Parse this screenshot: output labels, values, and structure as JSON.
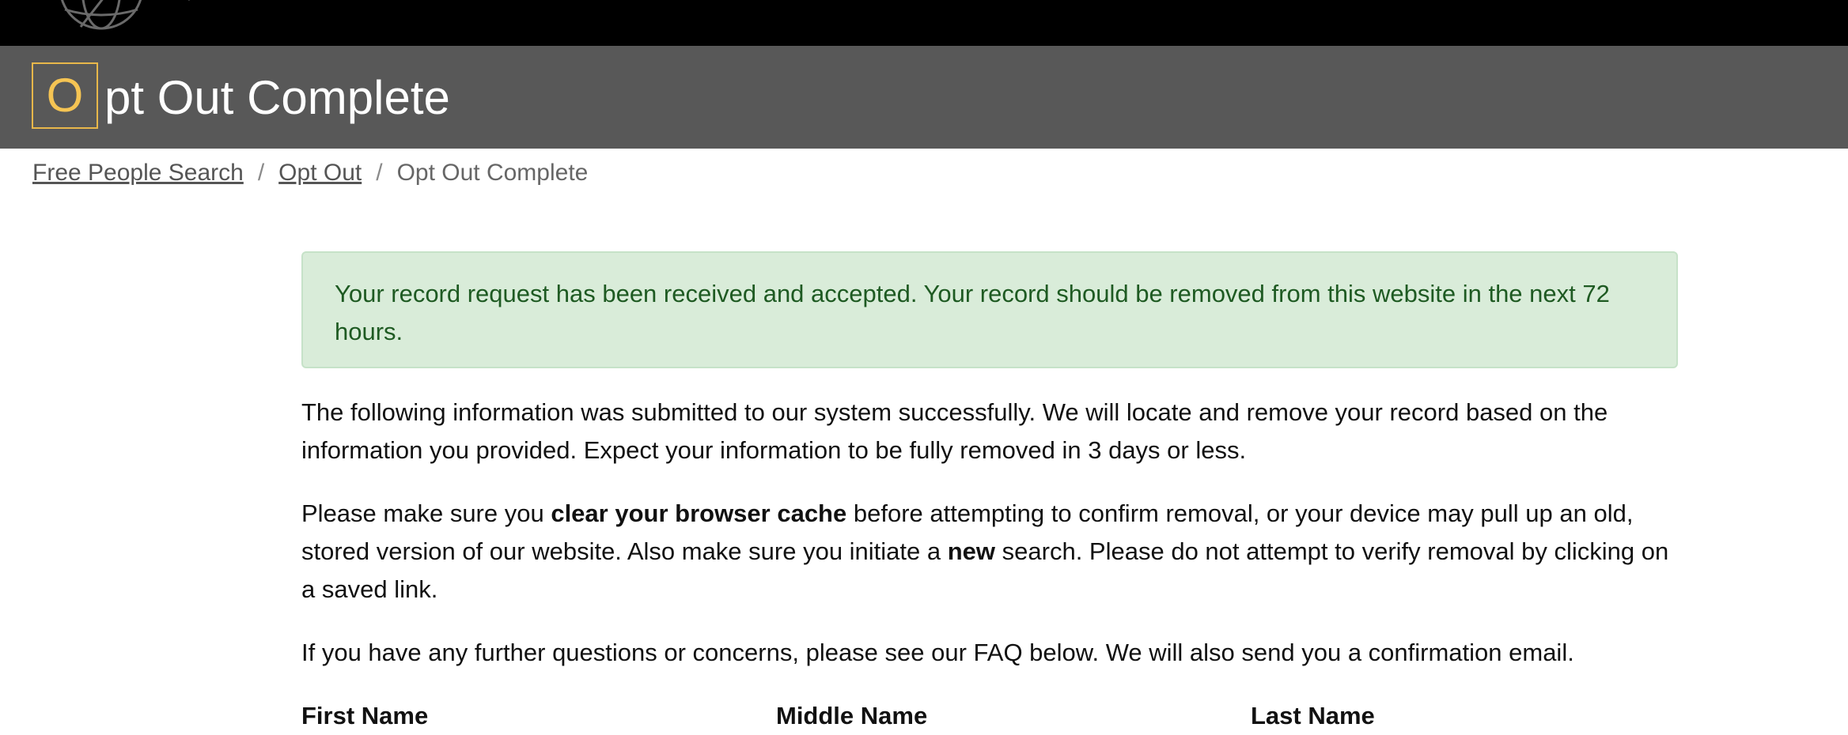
{
  "header": {
    "title_initial": "O",
    "title_rest": "pt Out Complete"
  },
  "breadcrumb": {
    "items": [
      {
        "label": "Free People Search"
      },
      {
        "label": "Opt Out"
      },
      {
        "label": "Opt Out Complete"
      }
    ],
    "separator": "/"
  },
  "alert": {
    "message": "Your record request has been received and accepted. Your record should be removed from this website in the next 72 hours."
  },
  "content": {
    "p1": "The following information was submitted to our system successfully. We will locate and remove your record based on the information you provided. Expect your information to be fully removed in 3 days or less.",
    "p2_part1": "Please make sure you ",
    "p2_bold1": "clear your browser cache",
    "p2_part2": " before attempting to confirm removal, or your device may pull up an old, stored version of our website. Also make sure you initiate a ",
    "p2_bold2": "new",
    "p2_part3": " search. Please do not attempt to verify removal by clicking on a saved link.",
    "p3": "If you have any further questions or concerns, please see our FAQ below. We will also send you a confirmation email."
  },
  "table": {
    "headers": [
      "First Name",
      "Middle Name",
      "Last Name"
    ]
  },
  "icons": {
    "logo": "globe-icon"
  },
  "colors": {
    "topbar": "#000000",
    "titlebar": "#585858",
    "accent": "#f5c453",
    "alert_bg": "#d9ecd9",
    "alert_text": "#1e5a22"
  }
}
